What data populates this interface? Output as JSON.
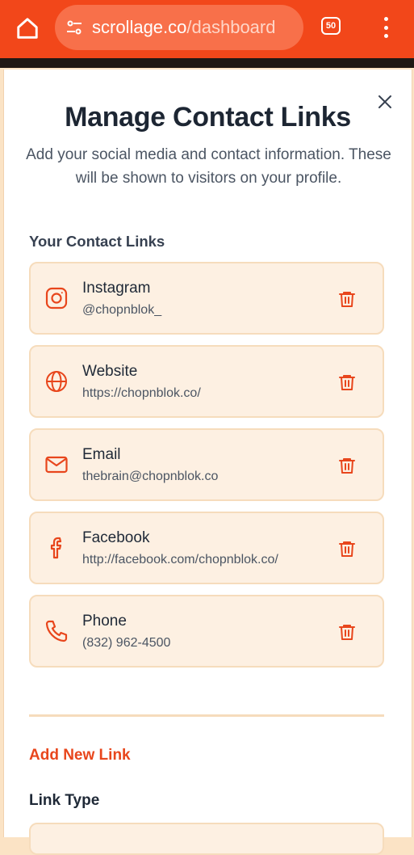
{
  "browser": {
    "url_host": "scrollage.co",
    "url_path": "/dashboard",
    "tab_count": "50",
    "accent_color": "#f2471a"
  },
  "modal": {
    "title": "Manage Contact Links",
    "subtitle": "Add your social media and contact information. These will be shown to visitors on your profile.",
    "section_label": "Your Contact Links",
    "links": [
      {
        "name": "Instagram",
        "value": "@chopnblok_",
        "icon": "instagram-icon"
      },
      {
        "name": "Website",
        "value": "https://chopnblok.co/",
        "icon": "globe-icon"
      },
      {
        "name": "Email",
        "value": "thebrain@chopnblok.co",
        "icon": "mail-icon"
      },
      {
        "name": "Facebook",
        "value": "http://facebook.com/chopnblok.co/",
        "icon": "facebook-icon"
      },
      {
        "name": "Phone",
        "value": "(832) 962-4500",
        "icon": "phone-icon"
      }
    ],
    "add_new_label": "Add New Link",
    "link_type_label": "Link Type",
    "accent_color": "#e8461c",
    "card_bg": "#fdf0e2",
    "card_border": "#f6dcbc"
  }
}
